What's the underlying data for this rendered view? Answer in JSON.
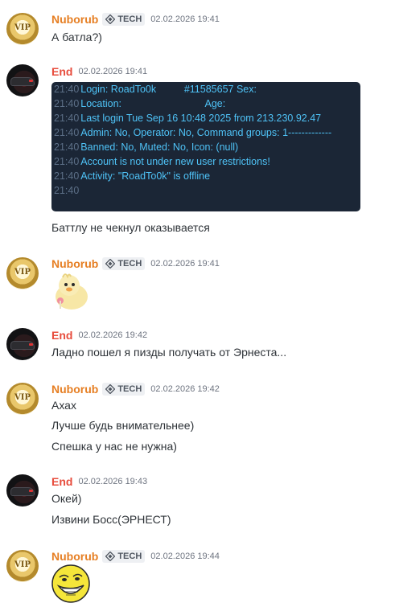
{
  "messages": [
    {
      "author": "Nuborub",
      "role_tag": "TECH",
      "time": "02.02.2026 19:41",
      "lines": [
        "А батла?)"
      ]
    },
    {
      "author": "End",
      "time": "02.02.2026 19:41",
      "code": [
        {
          "ts": "21:40",
          "text": "Login: RoadTo0k          #11585657 Sex:"
        },
        {
          "ts": "21:40",
          "text": "Location:                              Age:"
        },
        {
          "ts": "21:40",
          "text": "Last login Tue Sep 16 10:48 2025 from 213.230.92.47"
        },
        {
          "ts": "21:40",
          "text": "Admin: No, Operator: No, Command groups: 1-------------"
        },
        {
          "ts": "21:40",
          "text": "Banned: No, Muted: No, Icon: (null)"
        },
        {
          "ts": "21:40",
          "text": "Account is not under new user restrictions!"
        },
        {
          "ts": "21:40",
          "text": "Activity: \"RoadTo0k\" is offline"
        },
        {
          "ts": "21:40",
          "text": ""
        }
      ],
      "lines": [
        "Баттлу не чекнул оказывается"
      ]
    },
    {
      "author": "Nuborub",
      "role_tag": "TECH",
      "time": "02.02.2026 19:41",
      "sticker": "duck-sticker"
    },
    {
      "author": "End",
      "time": "02.02.2026 19:42",
      "lines": [
        "Ладно пошел я пизды получать от Эрнеста..."
      ]
    },
    {
      "author": "Nuborub",
      "role_tag": "TECH",
      "time": "02.02.2026 19:42",
      "lines": [
        "Ахах",
        "Лучше будь внимательнее)",
        "Спешка у нас не нужна)"
      ]
    },
    {
      "author": "End",
      "time": "02.02.2026 19:43",
      "lines": [
        "Окей)",
        "Извини Босс(ЭРНЕСТ)"
      ]
    },
    {
      "author": "Nuborub",
      "role_tag": "TECH",
      "time": "02.02.2026 19:44",
      "sticker": "troll-face-sticker"
    }
  ],
  "avatar_labels": {
    "vip": "VIP"
  },
  "colors": {
    "nuborub": "#e67e22",
    "end": "#e74c3c",
    "code_bg": "#1b2636",
    "code_text": "#4fc3f7"
  }
}
